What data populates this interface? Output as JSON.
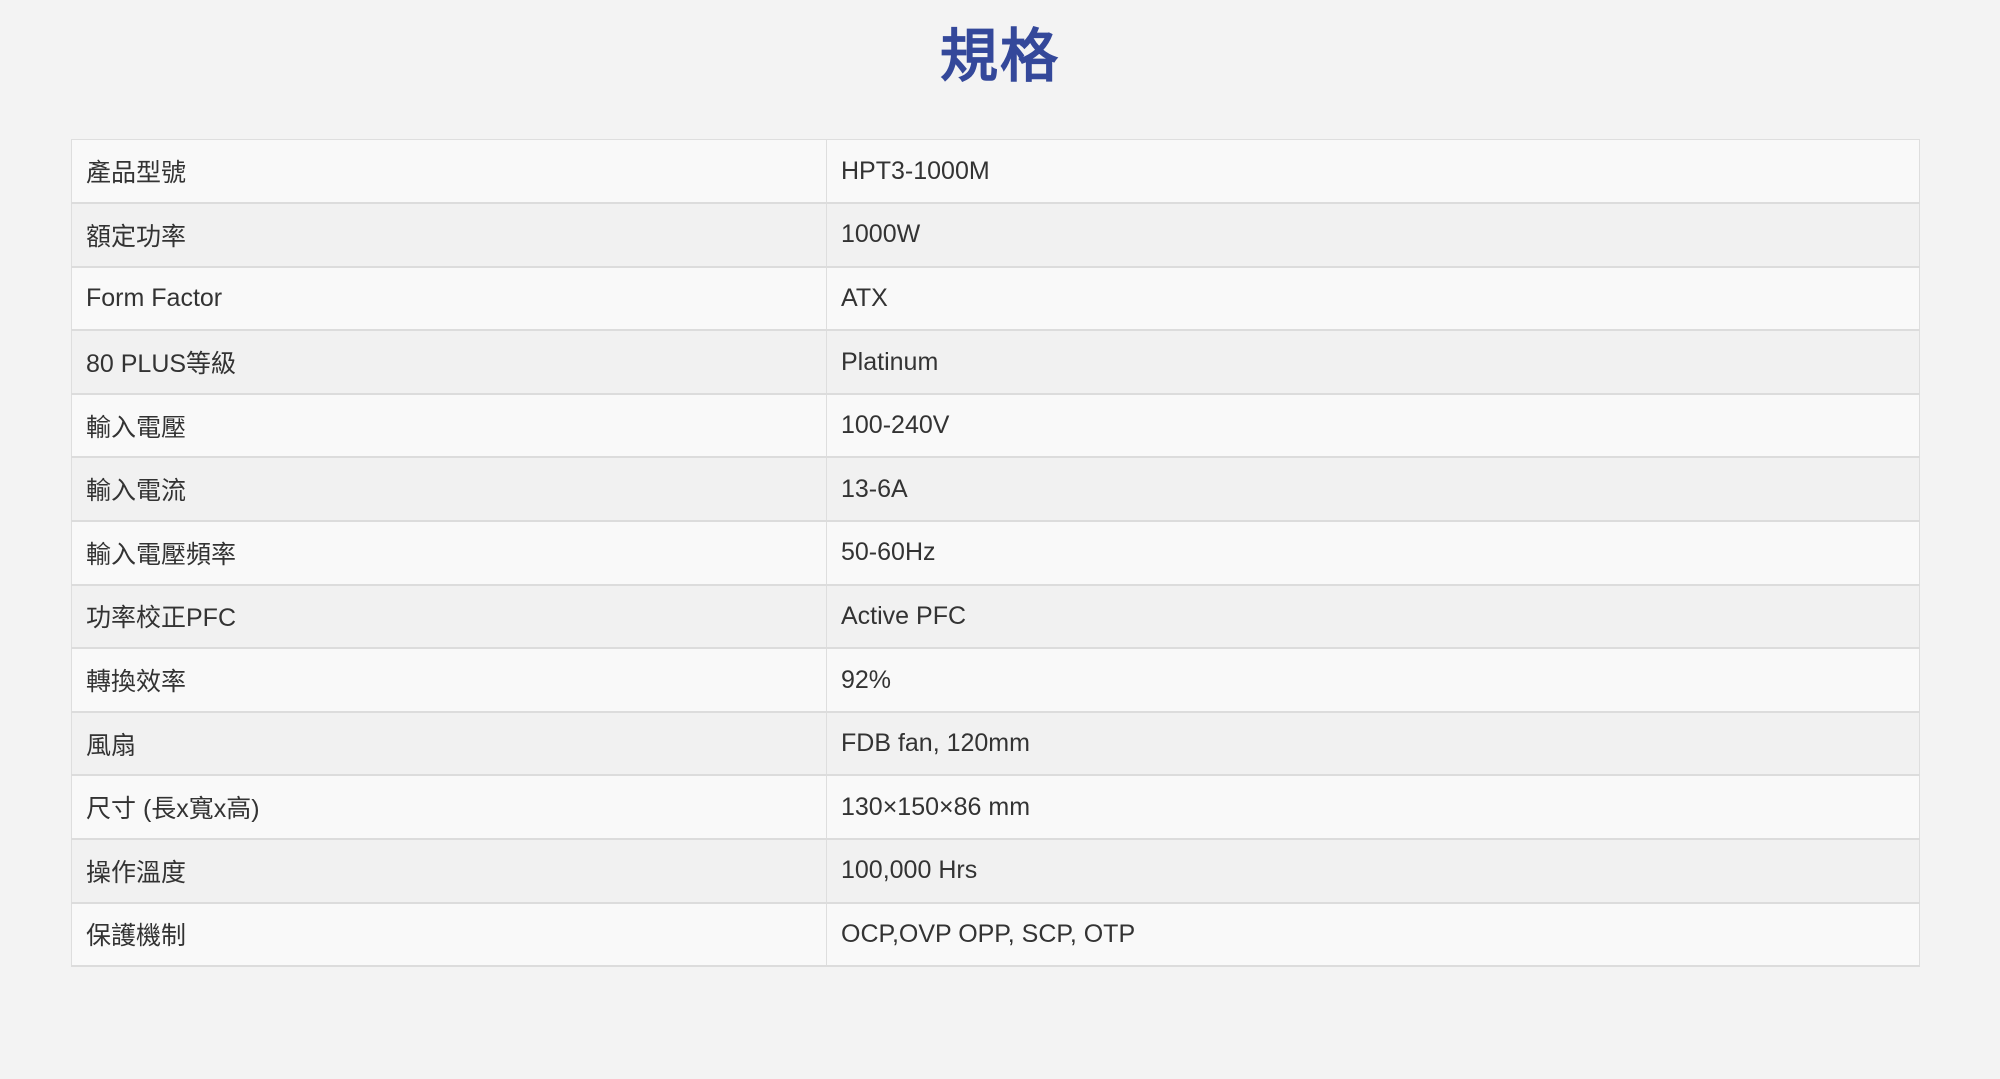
{
  "title": "規格",
  "specs": [
    {
      "label": "產品型號",
      "value": "HPT3-1000M"
    },
    {
      "label": "額定功率",
      "value": "1000W"
    },
    {
      "label": "Form Factor",
      "value": "ATX"
    },
    {
      "label": "80 PLUS等級",
      "value": "Platinum"
    },
    {
      "label": "輸入電壓",
      "value": "100-240V"
    },
    {
      "label": "輸入電流",
      "value": "13-6A"
    },
    {
      "label": "輸入電壓頻率",
      "value": "50-60Hz"
    },
    {
      "label": "功率校正PFC",
      "value": "Active PFC"
    },
    {
      "label": "轉換效率",
      "value": "92%"
    },
    {
      "label": "風扇",
      "value": "FDB fan, 120mm"
    },
    {
      "label": "尺寸 (長x寬x高)",
      "value": "130×150×86 mm"
    },
    {
      "label": "操作溫度",
      "value": "100,000 Hrs"
    },
    {
      "label": "保護機制",
      "value": "OCP,OVP OPP, SCP, OTP"
    }
  ]
}
